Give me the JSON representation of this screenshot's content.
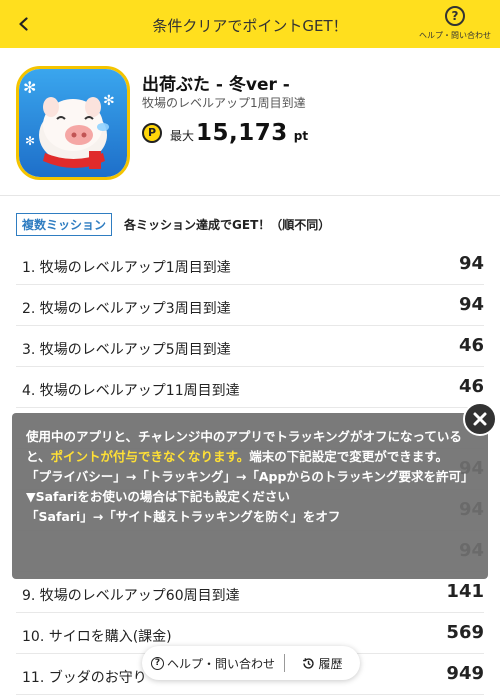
{
  "header": {
    "title": "条件クリアでポイントGET！",
    "help_label": "ヘルプ・問い合わせ",
    "help_icon_glyph": "?"
  },
  "app": {
    "name": "出荷ぶた - 冬ver -",
    "subtitle": "牧場のレベルアップ1周目到達",
    "point_badge": "P",
    "max_label": "最大",
    "max_points": "15,173",
    "points_unit": "pt"
  },
  "missions_header": {
    "tag": "複数ミッション",
    "note": "各ミッション達成でGET！（順不同）"
  },
  "missions": [
    {
      "label": "1. 牧場のレベルアップ1周目到達",
      "points": "94"
    },
    {
      "label": "2. 牧場のレベルアップ3周目到達",
      "points": "94"
    },
    {
      "label": "3. 牧場のレベルアップ5周目到達",
      "points": "46"
    },
    {
      "label": "4. 牧場のレベルアップ11周目到達",
      "points": "46"
    },
    {
      "label": "",
      "points": ""
    },
    {
      "label": "",
      "points": "94"
    },
    {
      "label": "",
      "points": "94"
    },
    {
      "label": "",
      "points": "94"
    },
    {
      "label": "9. 牧場のレベルアップ60周目到達",
      "points": "141"
    },
    {
      "label": "10. サイロを購入(課金)",
      "points": "569"
    },
    {
      "label": "11. ブッダのお守り",
      "points": "949"
    }
  ],
  "tracking_notice": {
    "line1_before": "使用中のアプリと、チャレンジ中のアプリでトラッキングがオフになっていると、",
    "line1_highlight": "ポイントが付与できなくなります。",
    "line1_after": "端末の下記設定で変更ができます。",
    "line2": "「プライバシー」→「トラッキング」→「Appからのトラッキング要求を許可」",
    "line3": "▼Safariをお使いの場合は下記も設定ください",
    "line4": "「Safari」→「サイト越えトラッキングを防ぐ」をオフ"
  },
  "bottom_bar": {
    "help_label": "ヘルプ・問い合わせ",
    "history_label": "履歴"
  },
  "colors": {
    "header_bg": "#ffdf1e",
    "highlight": "#ffe035",
    "mission_tag": "#2f7dc1"
  },
  "icons": {
    "back": "chevron-left-icon",
    "help": "question-circle-icon",
    "close": "close-icon",
    "history": "history-clock-icon"
  }
}
